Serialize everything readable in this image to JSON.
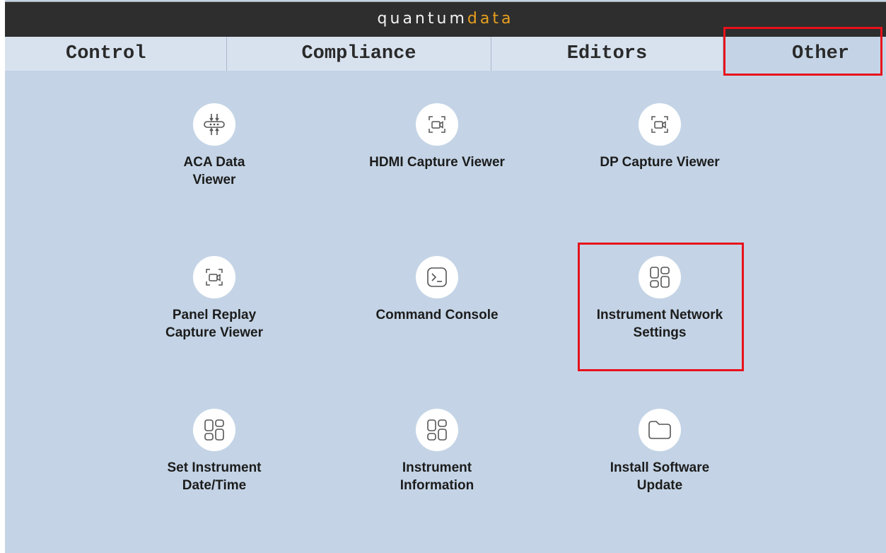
{
  "header": {
    "brand_part1": "quantum",
    "brand_part2": "data"
  },
  "tabs": [
    {
      "label": "Control"
    },
    {
      "label": "Compliance"
    },
    {
      "label": "Editors"
    },
    {
      "label": "Other",
      "selected": true
    }
  ],
  "tiles": [
    {
      "label_line1": "ACA Data",
      "label_line2": "Viewer",
      "icon": "aca-data-icon"
    },
    {
      "label_line1": "HDMI Capture Viewer",
      "label_line2": "",
      "icon": "capture-camera-icon"
    },
    {
      "label_line1": "DP Capture Viewer",
      "label_line2": "",
      "icon": "capture-camera-icon"
    },
    {
      "label_line1": "Panel Replay",
      "label_line2": "Capture Viewer",
      "icon": "capture-camera-icon"
    },
    {
      "label_line1": "Command Console",
      "label_line2": "",
      "icon": "terminal-icon"
    },
    {
      "label_line1": "Instrument Network",
      "label_line2": "Settings",
      "icon": "apps-grid-icon"
    },
    {
      "label_line1": "Set Instrument",
      "label_line2": "Date/Time",
      "icon": "apps-grid-icon"
    },
    {
      "label_line1": "Instrument",
      "label_line2": "Information",
      "icon": "apps-grid-icon"
    },
    {
      "label_line1": "Install Software",
      "label_line2": "Update",
      "icon": "folder-icon"
    }
  ],
  "colors": {
    "background": "#c4d4e6",
    "tab_inactive": "#d8e2ef",
    "titlebar": "#2e2e2e",
    "brand_accent": "#e7a01e",
    "highlight": "#e8111b"
  }
}
